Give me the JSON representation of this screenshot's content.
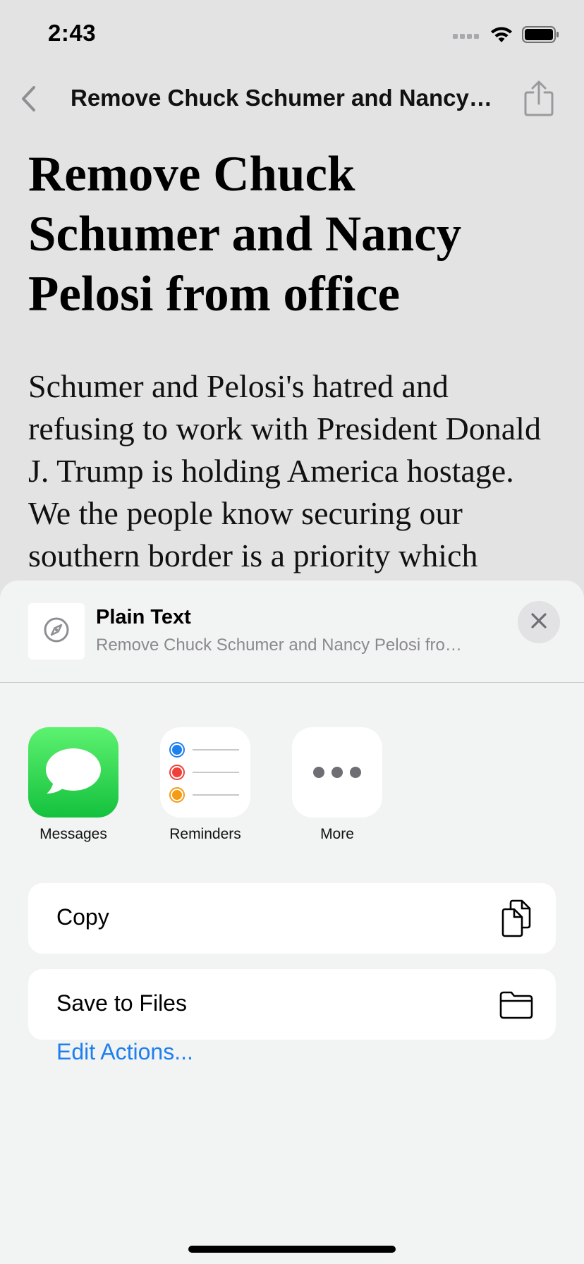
{
  "status_bar": {
    "time": "2:43"
  },
  "nav": {
    "title": "Remove Chuck Schumer and Nancy…"
  },
  "article": {
    "title": "Remove Chuck Schumer and Nancy Pelosi from office",
    "body": "Schumer and Pelosi's hatred and refusing to work with President Donald J. Trump is holding America hostage. We the people know securing our southern border is a priority which"
  },
  "share_sheet": {
    "preview": {
      "title": "Plain Text",
      "subtitle": "Remove Chuck Schumer and Nancy Pelosi fro…"
    },
    "apps": [
      {
        "label": "Messages",
        "icon": "messages-icon"
      },
      {
        "label": "Reminders",
        "icon": "reminders-icon"
      },
      {
        "label": "More",
        "icon": "more-icon"
      }
    ],
    "actions": [
      {
        "label": "Copy",
        "icon": "copy-icon"
      },
      {
        "label": "Save to Files",
        "icon": "folder-icon"
      }
    ],
    "edit_actions": "Edit Actions..."
  },
  "colors": {
    "accent": "#1d7ff0",
    "messages_green": "#14c13d",
    "sheet_bg": "#f2f3f3",
    "dimmed_bg": "#e3e3e3"
  }
}
